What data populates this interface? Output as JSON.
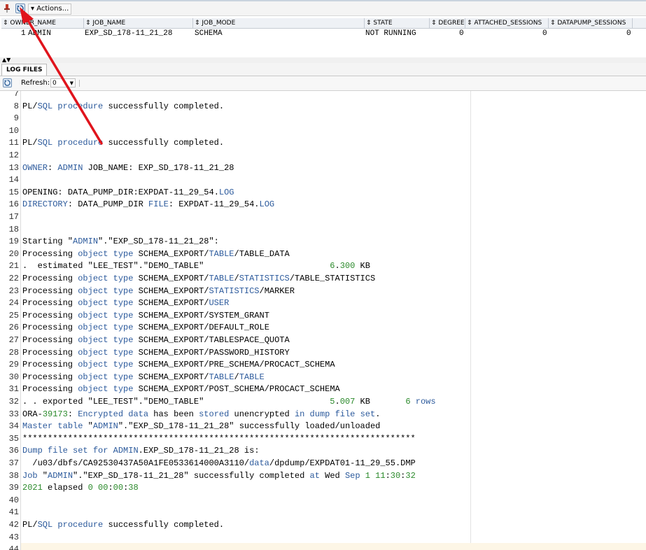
{
  "toolbar": {
    "actions_label": "▾ Actions..."
  },
  "grid": {
    "columns": [
      "OWNER_NAME",
      "JOB_NAME",
      "JOB_MODE",
      "STATE",
      "DEGREE",
      "ATTACHED_SESSIONS",
      "DATAPUMP_SESSIONS"
    ],
    "rows": [
      {
        "num": "1",
        "owner_name": "ADMIN",
        "job_name": "EXP_SD_178-11_21_28",
        "job_mode": "SCHEMA",
        "state": "NOT RUNNING",
        "degree": "0",
        "attached_sessions": "0",
        "datapump_sessions": "0"
      }
    ]
  },
  "log_panel": {
    "tab_label": "LOG FILES",
    "refresh_label": "Refresh:",
    "refresh_value": "0"
  },
  "log_lines": [
    {
      "n": "7",
      "t": ""
    },
    {
      "n": "8",
      "t": "PL/SQL procedure successfully completed."
    },
    {
      "n": "9",
      "t": ""
    },
    {
      "n": "10",
      "t": ""
    },
    {
      "n": "11",
      "t": "PL/SQL procedure successfully completed."
    },
    {
      "n": "12",
      "t": ""
    },
    {
      "n": "13",
      "t": "OWNER: ADMIN JOB_NAME: EXP_SD_178-11_21_28"
    },
    {
      "n": "14",
      "t": ""
    },
    {
      "n": "15",
      "t": "OPENING: DATA_PUMP_DIR:EXPDAT-11_29_54.LOG"
    },
    {
      "n": "16",
      "t": "DIRECTORY: DATA_PUMP_DIR FILE: EXPDAT-11_29_54.LOG"
    },
    {
      "n": "17",
      "t": ""
    },
    {
      "n": "18",
      "t": ""
    },
    {
      "n": "19",
      "t": "Starting \"ADMIN\".\"EXP_SD_178-11_21_28\":"
    },
    {
      "n": "20",
      "t": "Processing object type SCHEMA_EXPORT/TABLE/TABLE_DATA"
    },
    {
      "n": "21",
      "t": ".  estimated \"LEE_TEST\".\"DEMO_TABLE\"                         6.300 KB"
    },
    {
      "n": "22",
      "t": "Processing object type SCHEMA_EXPORT/TABLE/STATISTICS/TABLE_STATISTICS"
    },
    {
      "n": "23",
      "t": "Processing object type SCHEMA_EXPORT/STATISTICS/MARKER"
    },
    {
      "n": "24",
      "t": "Processing object type SCHEMA_EXPORT/USER"
    },
    {
      "n": "25",
      "t": "Processing object type SCHEMA_EXPORT/SYSTEM_GRANT"
    },
    {
      "n": "26",
      "t": "Processing object type SCHEMA_EXPORT/DEFAULT_ROLE"
    },
    {
      "n": "27",
      "t": "Processing object type SCHEMA_EXPORT/TABLESPACE_QUOTA"
    },
    {
      "n": "28",
      "t": "Processing object type SCHEMA_EXPORT/PASSWORD_HISTORY"
    },
    {
      "n": "29",
      "t": "Processing object type SCHEMA_EXPORT/PRE_SCHEMA/PROCACT_SCHEMA"
    },
    {
      "n": "30",
      "t": "Processing object type SCHEMA_EXPORT/TABLE/TABLE"
    },
    {
      "n": "31",
      "t": "Processing object type SCHEMA_EXPORT/POST_SCHEMA/PROCACT_SCHEMA"
    },
    {
      "n": "32",
      "t": ". . exported \"LEE_TEST\".\"DEMO_TABLE\"                         5.007 KB       6 rows"
    },
    {
      "n": "33",
      "t": "ORA-39173: Encrypted data has been stored unencrypted in dump file set."
    },
    {
      "n": "34",
      "t": "Master table \"ADMIN\".\"EXP_SD_178-11_21_28\" successfully loaded/unloaded"
    },
    {
      "n": "35",
      "t": "******************************************************************************"
    },
    {
      "n": "36",
      "t": "Dump file set for ADMIN.EXP_SD_178-11_21_28 is:"
    },
    {
      "n": "37",
      "t": "  /u03/dbfs/CA92530437A50A1FE0533614000A3110/data/dpdump/EXPDAT01-11_29_55.DMP"
    },
    {
      "n": "38",
      "t": "Job \"ADMIN\".\"EXP_SD_178-11_21_28\" successfully completed at Wed Sep 1 11:30:32"
    },
    {
      "n": "39",
      "t": "2021 elapsed 0 00:00:38"
    },
    {
      "n": "40",
      "t": ""
    },
    {
      "n": "41",
      "t": ""
    },
    {
      "n": "42",
      "t": "PL/SQL procedure successfully completed."
    },
    {
      "n": "43",
      "t": ""
    },
    {
      "n": "44",
      "t": ""
    }
  ],
  "highlight_words": [
    "SQL",
    "procedure",
    "OWNER",
    "ADMIN",
    "LOG",
    "DIRECTORY",
    "FILE",
    "object",
    "type",
    "TABLE",
    "STATISTICS",
    "USER",
    "rows",
    "Encrypted",
    "data",
    "stored",
    "in",
    "dump",
    "file",
    "set",
    "Master",
    "table",
    "Dump",
    "for",
    "Job",
    "at",
    "Sep"
  ],
  "colors": {
    "keyword": "#2c5a9c",
    "number": "#2b8a2b",
    "annotation_arrow": "#e0141c"
  }
}
